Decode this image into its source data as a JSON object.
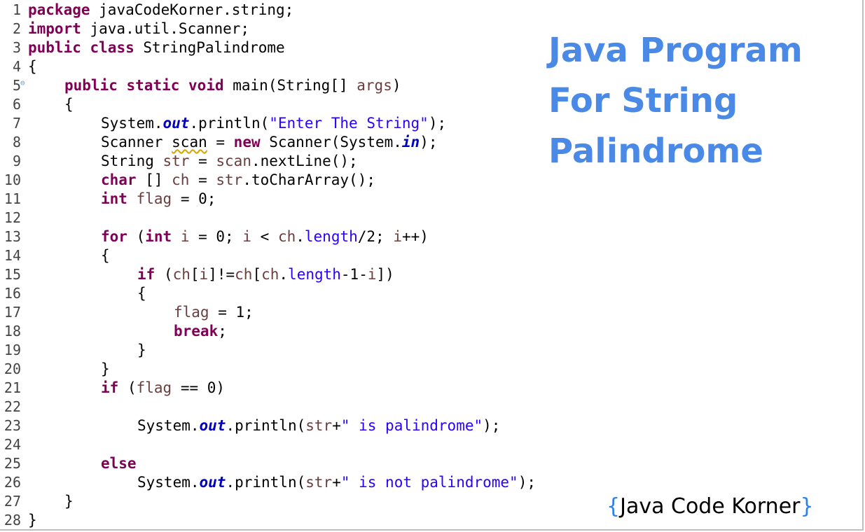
{
  "title": {
    "line1": "Java Program",
    "line2": "For String",
    "line3": "Palindrome"
  },
  "brand": {
    "open": "{",
    "name": "Java Code Korner",
    "close": "}"
  },
  "lines": [
    {
      "n": "1",
      "indent": 0,
      "tokens": [
        {
          "t": "kw",
          "v": "package"
        },
        {
          "t": "plain",
          "v": " javaCodeKorner.string;"
        }
      ]
    },
    {
      "n": "2",
      "indent": 0,
      "tokens": [
        {
          "t": "kw",
          "v": "import"
        },
        {
          "t": "plain",
          "v": " java.util.Scanner;"
        }
      ]
    },
    {
      "n": "3",
      "indent": 0,
      "tokens": [
        {
          "t": "kw",
          "v": "public"
        },
        {
          "t": "plain",
          "v": " "
        },
        {
          "t": "kw",
          "v": "class"
        },
        {
          "t": "plain",
          "v": " StringPalindrome"
        }
      ]
    },
    {
      "n": "4",
      "indent": 0,
      "tokens": [
        {
          "t": "plain",
          "v": "{"
        }
      ]
    },
    {
      "n": "5",
      "indent": 1,
      "fold": true,
      "tokens": [
        {
          "t": "kw",
          "v": "public"
        },
        {
          "t": "plain",
          "v": " "
        },
        {
          "t": "kw",
          "v": "static"
        },
        {
          "t": "plain",
          "v": " "
        },
        {
          "t": "kw",
          "v": "void"
        },
        {
          "t": "plain",
          "v": " main(String[] "
        },
        {
          "t": "var",
          "v": "args"
        },
        {
          "t": "plain",
          "v": ")"
        }
      ]
    },
    {
      "n": "6",
      "indent": 1,
      "tokens": [
        {
          "t": "plain",
          "v": "{"
        }
      ]
    },
    {
      "n": "7",
      "indent": 2,
      "tokens": [
        {
          "t": "plain",
          "v": "System."
        },
        {
          "t": "fld",
          "v": "out"
        },
        {
          "t": "plain",
          "v": ".println("
        },
        {
          "t": "str",
          "v": "\"Enter The String\""
        },
        {
          "t": "plain",
          "v": ");"
        }
      ]
    },
    {
      "n": "8",
      "indent": 2,
      "tokens": [
        {
          "t": "plain",
          "v": "Scanner "
        },
        {
          "t": "warn",
          "v": "scan"
        },
        {
          "t": "plain",
          "v": " = "
        },
        {
          "t": "kw",
          "v": "new"
        },
        {
          "t": "plain",
          "v": " Scanner(System."
        },
        {
          "t": "fld",
          "v": "in"
        },
        {
          "t": "plain",
          "v": ");"
        }
      ]
    },
    {
      "n": "9",
      "indent": 2,
      "tokens": [
        {
          "t": "plain",
          "v": "String "
        },
        {
          "t": "var",
          "v": "str"
        },
        {
          "t": "plain",
          "v": " = "
        },
        {
          "t": "var",
          "v": "scan"
        },
        {
          "t": "plain",
          "v": ".nextLine();"
        }
      ]
    },
    {
      "n": "10",
      "indent": 2,
      "tokens": [
        {
          "t": "kw",
          "v": "char"
        },
        {
          "t": "plain",
          "v": " [] "
        },
        {
          "t": "var",
          "v": "ch"
        },
        {
          "t": "plain",
          "v": " = "
        },
        {
          "t": "var",
          "v": "str"
        },
        {
          "t": "plain",
          "v": ".toCharArray();"
        }
      ]
    },
    {
      "n": "11",
      "indent": 2,
      "tokens": [
        {
          "t": "kw",
          "v": "int"
        },
        {
          "t": "plain",
          "v": " "
        },
        {
          "t": "var",
          "v": "flag"
        },
        {
          "t": "plain",
          "v": " = 0;"
        }
      ]
    },
    {
      "n": "12",
      "indent": 0,
      "tokens": []
    },
    {
      "n": "13",
      "indent": 2,
      "tokens": [
        {
          "t": "kw",
          "v": "for"
        },
        {
          "t": "plain",
          "v": " ("
        },
        {
          "t": "kw",
          "v": "int"
        },
        {
          "t": "plain",
          "v": " "
        },
        {
          "t": "var",
          "v": "i"
        },
        {
          "t": "plain",
          "v": " = 0; "
        },
        {
          "t": "var",
          "v": "i"
        },
        {
          "t": "plain",
          "v": " < "
        },
        {
          "t": "var",
          "v": "ch"
        },
        {
          "t": "plain",
          "v": "."
        },
        {
          "t": "str",
          "v": "length"
        },
        {
          "t": "plain",
          "v": "/2; "
        },
        {
          "t": "var",
          "v": "i"
        },
        {
          "t": "plain",
          "v": "++)"
        }
      ]
    },
    {
      "n": "14",
      "indent": 2,
      "tokens": [
        {
          "t": "plain",
          "v": "{"
        }
      ]
    },
    {
      "n": "15",
      "indent": 3,
      "tokens": [
        {
          "t": "kw",
          "v": "if"
        },
        {
          "t": "plain",
          "v": " ("
        },
        {
          "t": "var",
          "v": "ch"
        },
        {
          "t": "plain",
          "v": "["
        },
        {
          "t": "var",
          "v": "i"
        },
        {
          "t": "plain",
          "v": "]!="
        },
        {
          "t": "var",
          "v": "ch"
        },
        {
          "t": "plain",
          "v": "["
        },
        {
          "t": "var",
          "v": "ch"
        },
        {
          "t": "plain",
          "v": "."
        },
        {
          "t": "str",
          "v": "length"
        },
        {
          "t": "plain",
          "v": "-1-"
        },
        {
          "t": "var",
          "v": "i"
        },
        {
          "t": "plain",
          "v": "])"
        }
      ]
    },
    {
      "n": "16",
      "indent": 3,
      "tokens": [
        {
          "t": "plain",
          "v": "{"
        }
      ]
    },
    {
      "n": "17",
      "indent": 4,
      "tokens": [
        {
          "t": "var",
          "v": "flag"
        },
        {
          "t": "plain",
          "v": " = 1;"
        }
      ]
    },
    {
      "n": "18",
      "indent": 4,
      "tokens": [
        {
          "t": "kw",
          "v": "break"
        },
        {
          "t": "plain",
          "v": ";"
        }
      ]
    },
    {
      "n": "19",
      "indent": 3,
      "tokens": [
        {
          "t": "plain",
          "v": "}"
        }
      ]
    },
    {
      "n": "20",
      "indent": 2,
      "tokens": [
        {
          "t": "plain",
          "v": "}"
        }
      ]
    },
    {
      "n": "21",
      "indent": 2,
      "tokens": [
        {
          "t": "kw",
          "v": "if"
        },
        {
          "t": "plain",
          "v": " ("
        },
        {
          "t": "var",
          "v": "flag"
        },
        {
          "t": "plain",
          "v": " == 0)"
        }
      ]
    },
    {
      "n": "22",
      "indent": 0,
      "tokens": []
    },
    {
      "n": "23",
      "indent": 3,
      "tokens": [
        {
          "t": "plain",
          "v": "System."
        },
        {
          "t": "fld",
          "v": "out"
        },
        {
          "t": "plain",
          "v": ".println("
        },
        {
          "t": "var",
          "v": "str"
        },
        {
          "t": "plain",
          "v": "+"
        },
        {
          "t": "str",
          "v": "\" is palindrome\""
        },
        {
          "t": "plain",
          "v": ");"
        }
      ]
    },
    {
      "n": "24",
      "indent": 0,
      "tokens": []
    },
    {
      "n": "25",
      "indent": 2,
      "tokens": [
        {
          "t": "kw",
          "v": "else"
        }
      ]
    },
    {
      "n": "26",
      "indent": 3,
      "tokens": [
        {
          "t": "plain",
          "v": "System."
        },
        {
          "t": "fld",
          "v": "out"
        },
        {
          "t": "plain",
          "v": ".println("
        },
        {
          "t": "var",
          "v": "str"
        },
        {
          "t": "plain",
          "v": "+"
        },
        {
          "t": "str",
          "v": "\" is not palindrome\""
        },
        {
          "t": "plain",
          "v": ");"
        }
      ]
    },
    {
      "n": "27",
      "indent": 1,
      "tokens": [
        {
          "t": "plain",
          "v": "}"
        }
      ]
    },
    {
      "n": "28",
      "indent": 0,
      "tokens": [
        {
          "t": "plain",
          "v": "}"
        }
      ]
    }
  ]
}
